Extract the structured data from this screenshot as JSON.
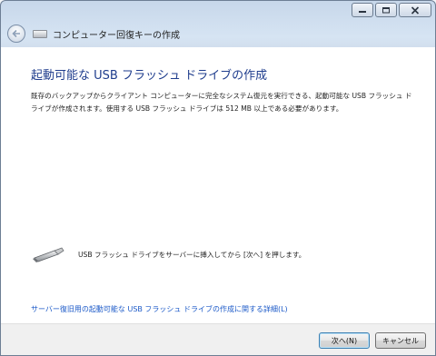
{
  "window": {
    "title": "コンピューター回復キーの作成",
    "caption_buttons": [
      "minimize-icon",
      "maximize-icon",
      "close-icon"
    ]
  },
  "content": {
    "heading": "起動可能な USB フラッシュ ドライブの作成",
    "description": "既存のバックアップからクライアント コンピューターに完全なシステム復元を実行できる、起動可能な USB フラッシュ ドライブが作成されます。使用する USB フラッシュ ドライブは 512 MB 以上である必要があります。",
    "instruction": "USB フラッシュ ドライブをサーバーに挿入してから [次へ] を押します。",
    "details_link": "サーバー復旧用の起動可能な USB フラッシュ ドライブの作成に関する詳細(L)"
  },
  "footer": {
    "next_label": "次へ(N)",
    "cancel_label": "キャンセル"
  },
  "colors": {
    "heading": "#1f3d8d",
    "link": "#1c5ac8",
    "titlebar": "#d6e4f3"
  }
}
